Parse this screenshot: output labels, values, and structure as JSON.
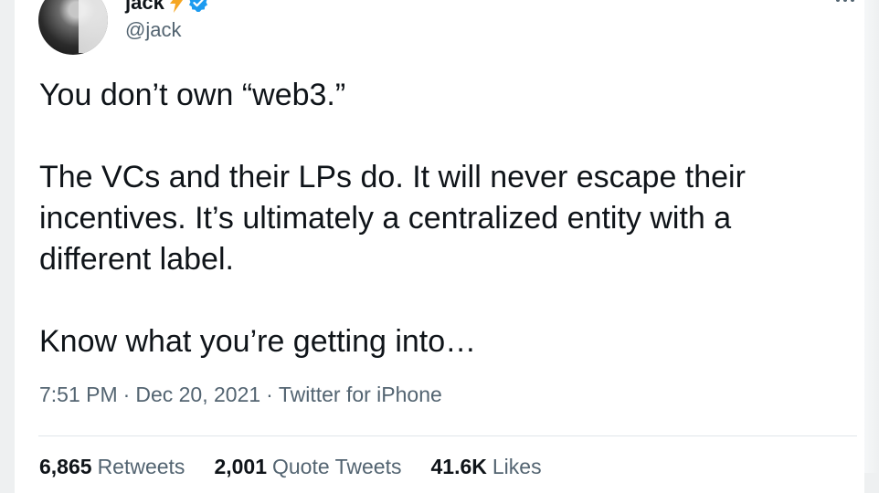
{
  "author": {
    "name": "jack",
    "handle": "@jack",
    "verified": true,
    "name_emoji_icon": "lightning-bolt-icon"
  },
  "tweet": {
    "paragraphs": [
      "You don’t own “web3.”",
      "The VCs and their LPs do. It will never escape their incentives. It’s ultimately a centralized entity with a different label.",
      "Know what you’re getting into…"
    ],
    "time": "7:51 PM",
    "separator": "·",
    "date": "Dec 20, 2021",
    "source": "Twitter for iPhone"
  },
  "stats": {
    "retweets_count": "6,865",
    "retweets_label": "Retweets",
    "quote_count": "2,001",
    "quote_label": "Quote Tweets",
    "likes_count": "41.6K",
    "likes_label": "Likes"
  },
  "colors": {
    "verified_blue": "#1d9bf0",
    "bolt_orange": "#f5a623",
    "text_primary": "#0f1419",
    "text_secondary": "#536471"
  }
}
